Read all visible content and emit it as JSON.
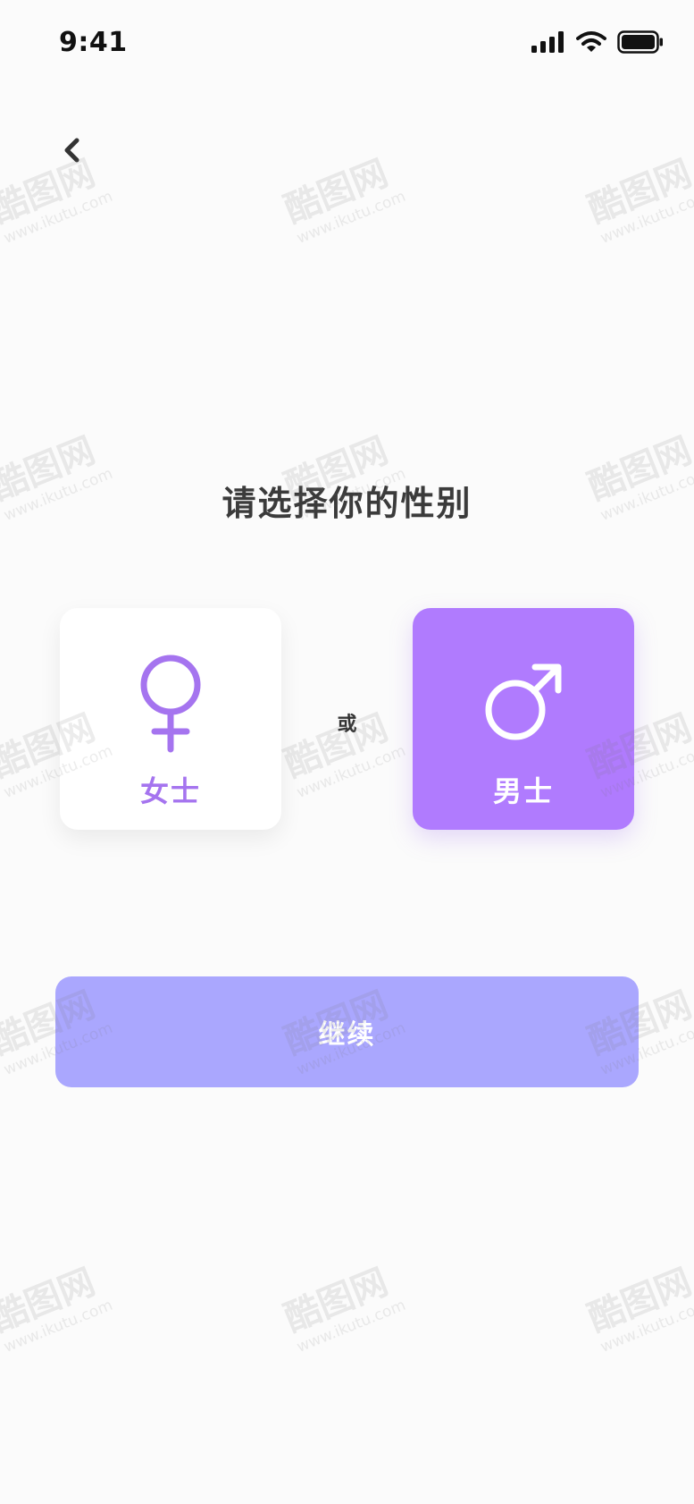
{
  "status_bar": {
    "time": "9:41",
    "icons": [
      "signal-icon",
      "wifi-icon",
      "battery-icon"
    ]
  },
  "nav": {
    "back_icon": "chevron-left-icon"
  },
  "title": "请选择你的性别",
  "options": {
    "female": {
      "label": "女士",
      "icon": "female-symbol-icon",
      "selected": false
    },
    "male": {
      "label": "男士",
      "icon": "male-symbol-icon",
      "selected": true
    },
    "separator": "或"
  },
  "continue_button": {
    "label": "继续"
  },
  "watermark": {
    "brand": "酷图网",
    "url": "www.ikutu.com"
  },
  "colors": {
    "accent": "#b07bfe",
    "accent_text": "#a574ef",
    "button": "#aaa7fe",
    "background": "#fbfbfb"
  }
}
